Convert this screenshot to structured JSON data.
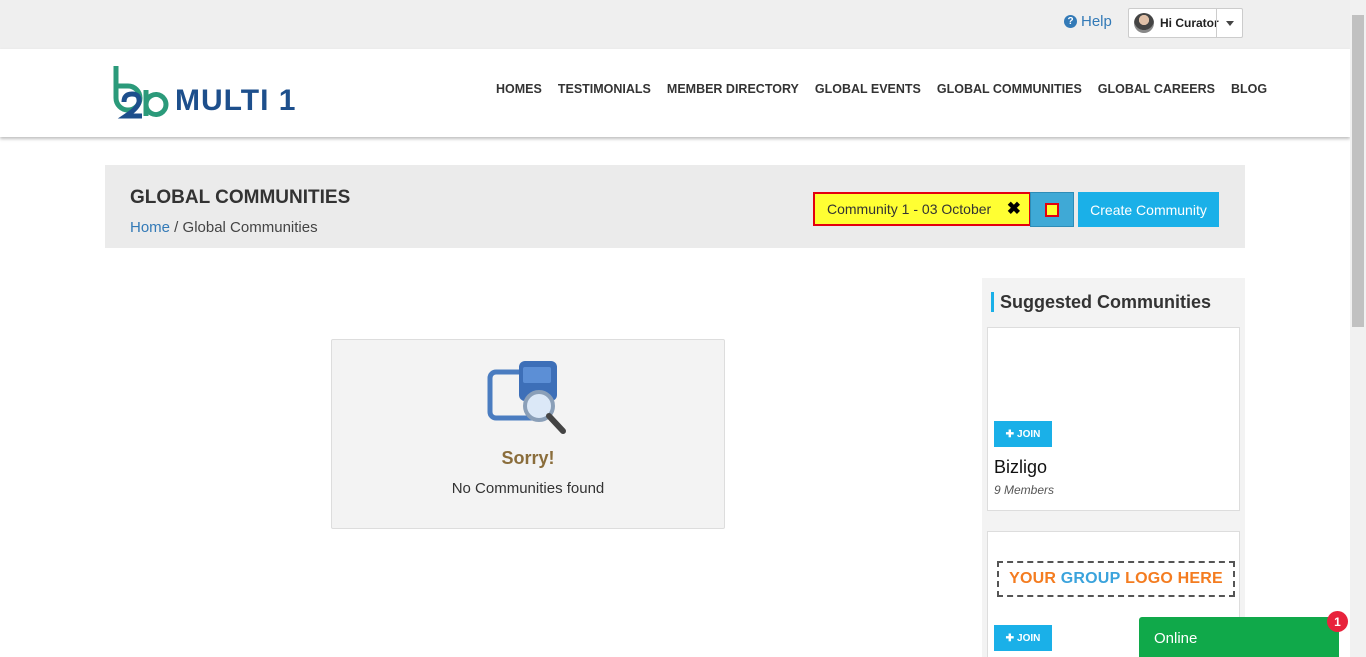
{
  "topbar": {
    "help_label": "Help",
    "user_label": "Hi Curator"
  },
  "brand": {
    "name": "MULTI 1"
  },
  "nav": {
    "items": [
      "HOMES",
      "TESTIMONIALS",
      "MEMBER DIRECTORY",
      "GLOBAL EVENTS",
      "GLOBAL COMMUNITIES",
      "GLOBAL CAREERS",
      "BLOG"
    ]
  },
  "page": {
    "title": "GLOBAL COMMUNITIES",
    "breadcrumb_home": "Home",
    "breadcrumb_sep": " / ",
    "breadcrumb_current": "Global Communities"
  },
  "search": {
    "value": "Community 1 - 03 October"
  },
  "actions": {
    "create_label": "Create Community"
  },
  "empty_state": {
    "heading": "Sorry!",
    "message": "No Communities found"
  },
  "sidebar": {
    "title": "Suggested Communities",
    "join_label": "JOIN",
    "communities": [
      {
        "name": "Bizligo",
        "members": "9 Members"
      },
      {
        "logo_text_1": "YOUR ",
        "logo_text_2": "GROUP ",
        "logo_text_3": "LOGO HERE"
      }
    ]
  },
  "chat": {
    "status": "Online",
    "badge_count": "1"
  },
  "colors": {
    "accent": "#1ab0e8",
    "brand_blue": "#1d4f8c",
    "brand_green": "#2b9a7a",
    "online_green": "#10a94a",
    "highlight_yellow": "#ffff33",
    "highlight_red": "#e3000f"
  }
}
